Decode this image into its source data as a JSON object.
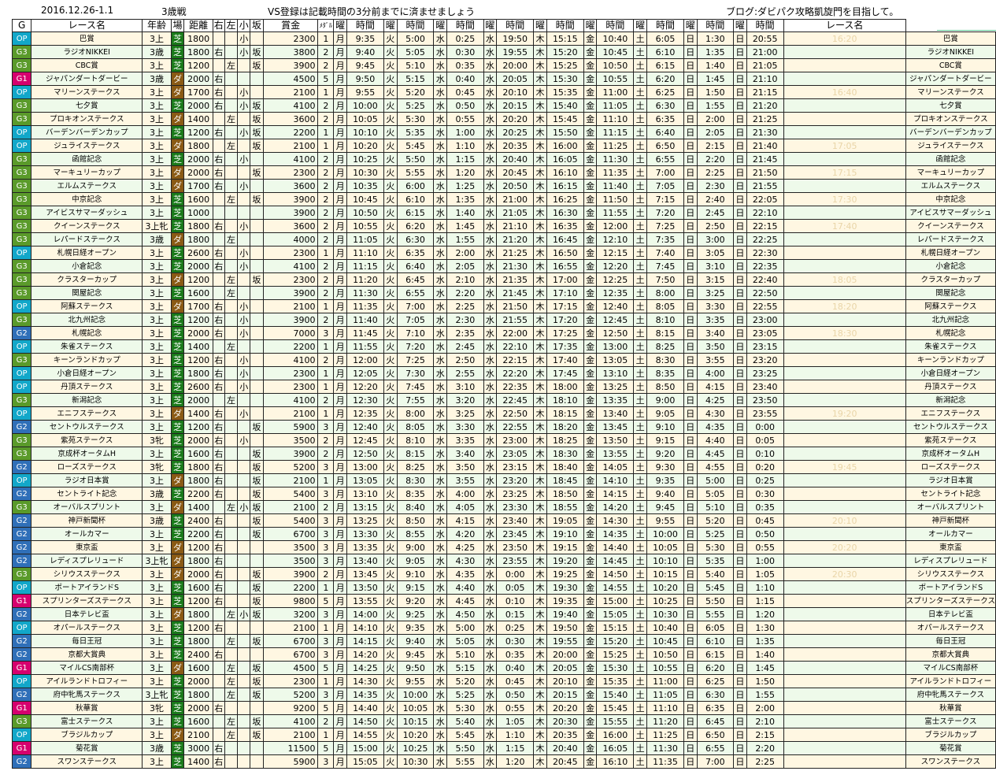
{
  "header": {
    "date_range": "2016.12.26-1.1",
    "category": "3歳戦",
    "notice": "VS登録は記載時間の3分前までに済ませましょう",
    "blog": "ブログ:ダビパク攻略凱旋門を目指して。"
  },
  "columns": [
    "G",
    "レース名",
    "年齢",
    "場",
    "距離",
    "右",
    "左",
    "小",
    "坂",
    "賞金",
    "ﾒﾀﾞﾙ",
    "曜",
    "時間",
    "曜",
    "時間",
    "曜",
    "時間",
    "曜",
    "時間",
    "曜",
    "時間",
    "曜",
    "時間",
    "曜",
    "時間",
    "曜",
    "時間",
    "曜",
    "時間",
    "レース名"
  ],
  "weekday_cols": [
    "月",
    "火",
    "水",
    "水",
    "木",
    "金",
    "土",
    "日",
    "日"
  ],
  "surface_colors": {
    "芝": "#1a7a1a",
    "ダ": "#8a5a14"
  },
  "grade_colors": {
    "G1": "#d6006e",
    "G2": "#2f6fb8",
    "G3": "#5a9a2a",
    "OP": "#12a7c9"
  },
  "rows": [
    [
      "OP",
      "巴賞",
      "3上",
      "芝",
      "1800",
      "",
      "",
      "小",
      "",
      "2300",
      "1",
      "9:35",
      "5:00",
      "0:25",
      "19:50",
      "15:15",
      "10:40",
      "6:05",
      "1:30",
      "20:55",
      "16:20"
    ],
    [
      "G3",
      "ラジオNIKKEI",
      "3歳",
      "芝",
      "1800",
      "右",
      "",
      "小",
      "坂",
      "3800",
      "2",
      "9:40",
      "5:05",
      "0:30",
      "19:55",
      "15:20",
      "10:45",
      "6:10",
      "1:35",
      "21:00",
      ""
    ],
    [
      "G3",
      "CBC賞",
      "3上",
      "芝",
      "1200",
      "",
      "左",
      "",
      "坂",
      "3900",
      "2",
      "9:45",
      "5:10",
      "0:35",
      "20:00",
      "15:25",
      "10:50",
      "6:15",
      "1:40",
      "21:05",
      ""
    ],
    [
      "G1",
      "ジャパンダートダービー",
      "3歳",
      "ダ",
      "2000",
      "右",
      "",
      "",
      "",
      "4500",
      "5",
      "9:50",
      "5:15",
      "0:40",
      "20:05",
      "15:30",
      "10:55",
      "6:20",
      "1:45",
      "21:10",
      ""
    ],
    [
      "OP",
      "マリーンステークス",
      "3上",
      "ダ",
      "1700",
      "右",
      "",
      "小",
      "",
      "2100",
      "1",
      "9:55",
      "5:20",
      "0:45",
      "20:10",
      "15:35",
      "11:00",
      "6:25",
      "1:50",
      "21:15",
      "16:40"
    ],
    [
      "G3",
      "七夕賞",
      "3上",
      "芝",
      "2000",
      "右",
      "",
      "小",
      "坂",
      "4100",
      "2",
      "10:00",
      "5:25",
      "0:50",
      "20:15",
      "15:40",
      "11:05",
      "6:30",
      "1:55",
      "21:20",
      ""
    ],
    [
      "G3",
      "プロキオンステークス",
      "3上",
      "ダ",
      "1400",
      "",
      "左",
      "",
      "坂",
      "3600",
      "2",
      "10:05",
      "5:30",
      "0:55",
      "20:20",
      "15:45",
      "11:10",
      "6:35",
      "2:00",
      "21:25",
      ""
    ],
    [
      "OP",
      "バーデンバーデンカップ",
      "3上",
      "芝",
      "1200",
      "右",
      "",
      "小",
      "坂",
      "2200",
      "1",
      "10:10",
      "5:35",
      "1:00",
      "20:25",
      "15:50",
      "11:15",
      "6:40",
      "2:05",
      "21:30",
      ""
    ],
    [
      "OP",
      "ジュライステークス",
      "3上",
      "ダ",
      "1800",
      "",
      "左",
      "",
      "坂",
      "2100",
      "1",
      "10:20",
      "5:45",
      "1:10",
      "20:35",
      "16:00",
      "11:25",
      "6:50",
      "2:15",
      "21:40",
      "17:05"
    ],
    [
      "G3",
      "函館記念",
      "3上",
      "芝",
      "2000",
      "右",
      "",
      "小",
      "",
      "4100",
      "2",
      "10:25",
      "5:50",
      "1:15",
      "20:40",
      "16:05",
      "11:30",
      "6:55",
      "2:20",
      "21:45",
      ""
    ],
    [
      "G3",
      "マーキュリーカップ",
      "3上",
      "ダ",
      "2000",
      "右",
      "",
      "",
      "坂",
      "2300",
      "2",
      "10:30",
      "5:55",
      "1:20",
      "20:45",
      "16:10",
      "11:35",
      "7:00",
      "2:25",
      "21:50",
      "17:15"
    ],
    [
      "G3",
      "エルムステークス",
      "3上",
      "ダ",
      "1700",
      "右",
      "",
      "小",
      "",
      "3600",
      "2",
      "10:35",
      "6:00",
      "1:25",
      "20:50",
      "16:15",
      "11:40",
      "7:05",
      "2:30",
      "21:55",
      ""
    ],
    [
      "G3",
      "中京記念",
      "3上",
      "芝",
      "1600",
      "",
      "左",
      "",
      "坂",
      "3900",
      "2",
      "10:45",
      "6:10",
      "1:35",
      "21:00",
      "16:25",
      "11:50",
      "7:15",
      "2:40",
      "22:05",
      "17:30"
    ],
    [
      "G3",
      "アイビスサマーダッシュ",
      "3上",
      "芝",
      "1000",
      "",
      "",
      "",
      "",
      "3900",
      "2",
      "10:50",
      "6:15",
      "1:40",
      "21:05",
      "16:30",
      "11:55",
      "7:20",
      "2:45",
      "22:10",
      ""
    ],
    [
      "G3",
      "クイーンステークス",
      "3上牝",
      "芝",
      "1800",
      "右",
      "",
      "小",
      "",
      "3600",
      "2",
      "10:55",
      "6:20",
      "1:45",
      "21:10",
      "16:35",
      "12:00",
      "7:25",
      "2:50",
      "22:15",
      "17:40"
    ],
    [
      "G3",
      "レパードステークス",
      "3歳",
      "ダ",
      "1800",
      "",
      "左",
      "",
      "",
      "4000",
      "2",
      "11:05",
      "6:30",
      "1:55",
      "21:20",
      "16:45",
      "12:10",
      "7:35",
      "3:00",
      "22:25",
      ""
    ],
    [
      "OP",
      "札幌日経オープン",
      "3上",
      "芝",
      "2600",
      "右",
      "",
      "小",
      "",
      "2300",
      "1",
      "11:10",
      "6:35",
      "2:00",
      "21:25",
      "16:50",
      "12:15",
      "7:40",
      "3:05",
      "22:30",
      ""
    ],
    [
      "G3",
      "小倉記念",
      "3上",
      "芝",
      "2000",
      "右",
      "",
      "小",
      "",
      "4100",
      "2",
      "11:15",
      "6:40",
      "2:05",
      "21:30",
      "16:55",
      "12:20",
      "7:45",
      "3:10",
      "22:35",
      ""
    ],
    [
      "G3",
      "クラスターカップ",
      "3上",
      "ダ",
      "1200",
      "",
      "左",
      "",
      "坂",
      "2300",
      "2",
      "11:20",
      "6:45",
      "2:10",
      "21:35",
      "17:00",
      "12:25",
      "7:50",
      "3:15",
      "22:40",
      "18:05"
    ],
    [
      "G3",
      "関屋記念",
      "3上",
      "芝",
      "1600",
      "",
      "左",
      "",
      "",
      "3900",
      "2",
      "11:30",
      "6:55",
      "2:20",
      "21:45",
      "17:10",
      "12:35",
      "8:00",
      "3:25",
      "22:50",
      ""
    ],
    [
      "OP",
      "阿蘇ステークス",
      "3上",
      "ダ",
      "1700",
      "右",
      "",
      "小",
      "",
      "2100",
      "1",
      "11:35",
      "7:00",
      "2:25",
      "21:50",
      "17:15",
      "12:40",
      "8:05",
      "3:30",
      "22:55",
      "18:20"
    ],
    [
      "G3",
      "北九州記念",
      "3上",
      "芝",
      "1200",
      "右",
      "",
      "小",
      "",
      "3900",
      "2",
      "11:40",
      "7:05",
      "2:30",
      "21:55",
      "17:20",
      "12:45",
      "8:10",
      "3:35",
      "23:00",
      ""
    ],
    [
      "G2",
      "札幌記念",
      "3上",
      "芝",
      "2000",
      "右",
      "",
      "小",
      "",
      "7000",
      "3",
      "11:45",
      "7:10",
      "2:35",
      "22:00",
      "17:25",
      "12:50",
      "8:15",
      "3:40",
      "23:05",
      "18:30"
    ],
    [
      "OP",
      "朱雀ステークス",
      "3上",
      "芝",
      "1400",
      "",
      "左",
      "",
      "",
      "2200",
      "1",
      "11:55",
      "7:20",
      "2:45",
      "22:10",
      "17:35",
      "13:00",
      "8:25",
      "3:50",
      "23:15",
      ""
    ],
    [
      "G3",
      "キーンランドカップ",
      "3上",
      "芝",
      "1200",
      "右",
      "",
      "小",
      "",
      "4100",
      "2",
      "12:00",
      "7:25",
      "2:50",
      "22:15",
      "17:40",
      "13:05",
      "8:30",
      "3:55",
      "23:20",
      ""
    ],
    [
      "OP",
      "小倉日経オープン",
      "3上",
      "芝",
      "1800",
      "右",
      "",
      "小",
      "",
      "2300",
      "1",
      "12:05",
      "7:30",
      "2:55",
      "22:20",
      "17:45",
      "13:10",
      "8:35",
      "4:00",
      "23:25",
      ""
    ],
    [
      "OP",
      "丹頂ステークス",
      "3上",
      "芝",
      "2600",
      "右",
      "",
      "小",
      "",
      "2300",
      "1",
      "12:20",
      "7:45",
      "3:10",
      "22:35",
      "18:00",
      "13:25",
      "8:50",
      "4:15",
      "23:40",
      ""
    ],
    [
      "G3",
      "新潟記念",
      "3上",
      "芝",
      "2000",
      "",
      "左",
      "",
      "",
      "4100",
      "2",
      "12:30",
      "7:55",
      "3:20",
      "22:45",
      "18:10",
      "13:35",
      "9:00",
      "4:25",
      "23:50",
      ""
    ],
    [
      "OP",
      "エニフステークス",
      "3上",
      "ダ",
      "1400",
      "右",
      "",
      "小",
      "",
      "2100",
      "1",
      "12:35",
      "8:00",
      "3:25",
      "22:50",
      "18:15",
      "13:40",
      "9:05",
      "4:30",
      "23:55",
      "19:20"
    ],
    [
      "G2",
      "セントウルステークス",
      "3上",
      "芝",
      "1200",
      "右",
      "",
      "",
      "坂",
      "5900",
      "3",
      "12:40",
      "8:05",
      "3:30",
      "22:55",
      "18:20",
      "13:45",
      "9:10",
      "4:35",
      "0:00",
      ""
    ],
    [
      "G3",
      "紫苑ステークス",
      "3牝",
      "芝",
      "2000",
      "右",
      "",
      "小",
      "",
      "3500",
      "2",
      "12:45",
      "8:10",
      "3:35",
      "23:00",
      "18:25",
      "13:50",
      "9:15",
      "4:40",
      "0:05",
      ""
    ],
    [
      "G3",
      "京成杯オータムH",
      "3上",
      "芝",
      "1600",
      "右",
      "",
      "",
      "坂",
      "3900",
      "2",
      "12:50",
      "8:15",
      "3:40",
      "23:05",
      "18:30",
      "13:55",
      "9:20",
      "4:45",
      "0:10",
      ""
    ],
    [
      "G2",
      "ローズステークス",
      "3牝",
      "芝",
      "1800",
      "右",
      "",
      "",
      "坂",
      "5200",
      "3",
      "13:00",
      "8:25",
      "3:50",
      "23:15",
      "18:40",
      "14:05",
      "9:30",
      "4:55",
      "0:20",
      "19:45"
    ],
    [
      "OP",
      "ラジオ日本賞",
      "3上",
      "ダ",
      "1800",
      "右",
      "",
      "",
      "坂",
      "2100",
      "1",
      "13:05",
      "8:30",
      "3:55",
      "23:20",
      "18:45",
      "14:10",
      "9:35",
      "5:00",
      "0:25",
      ""
    ],
    [
      "G2",
      "セントライト記念",
      "3歳",
      "芝",
      "2200",
      "右",
      "",
      "",
      "坂",
      "5400",
      "3",
      "13:10",
      "8:35",
      "4:00",
      "23:25",
      "18:50",
      "14:15",
      "9:40",
      "5:05",
      "0:30",
      ""
    ],
    [
      "G3",
      "オーバルスプリント",
      "3上",
      "ダ",
      "1400",
      "",
      "左",
      "小",
      "坂",
      "2100",
      "2",
      "13:15",
      "8:40",
      "4:05",
      "23:30",
      "18:55",
      "14:20",
      "9:45",
      "5:10",
      "0:35",
      ""
    ],
    [
      "G2",
      "神戸新聞杯",
      "3歳",
      "芝",
      "2400",
      "右",
      "",
      "",
      "坂",
      "5400",
      "3",
      "13:25",
      "8:50",
      "4:15",
      "23:40",
      "19:05",
      "14:30",
      "9:55",
      "5:20",
      "0:45",
      "20:10"
    ],
    [
      "G2",
      "オールカマー",
      "3上",
      "芝",
      "2200",
      "右",
      "",
      "",
      "坂",
      "6700",
      "3",
      "13:30",
      "8:55",
      "4:20",
      "23:45",
      "19:10",
      "14:35",
      "10:00",
      "5:25",
      "0:50",
      ""
    ],
    [
      "G2",
      "東京盃",
      "3上",
      "ダ",
      "1200",
      "右",
      "",
      "",
      "",
      "3500",
      "3",
      "13:35",
      "9:00",
      "4:25",
      "23:50",
      "19:15",
      "14:40",
      "10:05",
      "5:30",
      "0:55",
      "20:20"
    ],
    [
      "G2",
      "レディスプレリュード",
      "3上牝",
      "ダ",
      "1800",
      "右",
      "",
      "",
      "",
      "3500",
      "3",
      "13:40",
      "9:05",
      "4:30",
      "23:55",
      "19:20",
      "14:45",
      "10:10",
      "5:35",
      "1:00",
      ""
    ],
    [
      "G3",
      "シリウスステークス",
      "3上",
      "ダ",
      "2000",
      "右",
      "",
      "",
      "坂",
      "3900",
      "2",
      "13:45",
      "9:10",
      "4:35",
      "0:00",
      "19:25",
      "14:50",
      "10:15",
      "5:40",
      "1:05",
      "20:30"
    ],
    [
      "OP",
      "ポートアイランドS",
      "3上",
      "芝",
      "1600",
      "右",
      "",
      "",
      "坂",
      "2200",
      "1",
      "13:50",
      "9:15",
      "4:40",
      "0:05",
      "19:30",
      "14:55",
      "10:20",
      "5:45",
      "1:10",
      ""
    ],
    [
      "G1",
      "スプリンターズステークス",
      "3上",
      "芝",
      "1200",
      "右",
      "",
      "",
      "坂",
      "9800",
      "5",
      "13:55",
      "9:20",
      "4:45",
      "0:10",
      "19:35",
      "15:00",
      "10:25",
      "5:50",
      "1:15",
      ""
    ],
    [
      "G2",
      "日本テレビ盃",
      "3上",
      "ダ",
      "1800",
      "",
      "左",
      "小",
      "坂",
      "3200",
      "3",
      "14:00",
      "9:25",
      "4:50",
      "0:15",
      "19:40",
      "15:05",
      "10:30",
      "5:55",
      "1:20",
      ""
    ],
    [
      "OP",
      "オパールステークス",
      "3上",
      "芝",
      "1200",
      "右",
      "",
      "",
      "",
      "2100",
      "1",
      "14:10",
      "9:35",
      "5:00",
      "0:25",
      "19:50",
      "15:15",
      "10:40",
      "6:05",
      "1:30",
      ""
    ],
    [
      "G2",
      "毎日王冠",
      "3上",
      "芝",
      "1800",
      "",
      "左",
      "",
      "坂",
      "6700",
      "3",
      "14:15",
      "9:40",
      "5:05",
      "0:30",
      "19:55",
      "15:20",
      "10:45",
      "6:10",
      "1:35",
      ""
    ],
    [
      "G2",
      "京都大賞典",
      "3上",
      "芝",
      "2400",
      "右",
      "",
      "",
      "",
      "6700",
      "3",
      "14:20",
      "9:45",
      "5:10",
      "0:35",
      "20:00",
      "15:25",
      "10:50",
      "6:15",
      "1:40",
      ""
    ],
    [
      "G1",
      "マイルCS南部杯",
      "3上",
      "ダ",
      "1600",
      "",
      "左",
      "",
      "坂",
      "4500",
      "5",
      "14:25",
      "9:50",
      "5:15",
      "0:40",
      "20:05",
      "15:30",
      "10:55",
      "6:20",
      "1:45",
      ""
    ],
    [
      "OP",
      "アイルランドトロフィー",
      "3上",
      "芝",
      "2000",
      "",
      "左",
      "",
      "坂",
      "2300",
      "1",
      "14:30",
      "9:55",
      "5:20",
      "0:45",
      "20:10",
      "15:35",
      "11:00",
      "6:25",
      "1:50",
      ""
    ],
    [
      "G2",
      "府中牝馬ステークス",
      "3上牝",
      "芝",
      "1800",
      "",
      "左",
      "",
      "坂",
      "5200",
      "3",
      "14:35",
      "10:00",
      "5:25",
      "0:50",
      "20:15",
      "15:40",
      "11:05",
      "6:30",
      "1:55",
      ""
    ],
    [
      "G1",
      "秋華賞",
      "3牝",
      "芝",
      "2000",
      "右",
      "",
      "",
      "",
      "9200",
      "5",
      "14:40",
      "10:05",
      "5:30",
      "0:55",
      "20:20",
      "15:45",
      "11:10",
      "6:35",
      "2:00",
      ""
    ],
    [
      "G3",
      "富士ステークス",
      "3上",
      "芝",
      "1600",
      "",
      "左",
      "",
      "坂",
      "4100",
      "2",
      "14:50",
      "10:15",
      "5:40",
      "1:05",
      "20:30",
      "15:55",
      "11:20",
      "6:45",
      "2:10",
      ""
    ],
    [
      "OP",
      "ブラジルカップ",
      "3上",
      "ダ",
      "2100",
      "",
      "左",
      "",
      "坂",
      "2100",
      "1",
      "14:55",
      "10:20",
      "5:45",
      "1:10",
      "20:35",
      "16:00",
      "11:25",
      "6:50",
      "2:15",
      ""
    ],
    [
      "G1",
      "菊花賞",
      "3歳",
      "芝",
      "3000",
      "右",
      "",
      "",
      "",
      "11500",
      "5",
      "15:00",
      "10:25",
      "5:50",
      "1:15",
      "20:40",
      "16:05",
      "11:30",
      "6:55",
      "2:20",
      ""
    ],
    [
      "G2",
      "スワンステークス",
      "3上",
      "芝",
      "1400",
      "右",
      "",
      "",
      "",
      "5900",
      "3",
      "15:05",
      "10:30",
      "5:55",
      "1:20",
      "20:45",
      "16:10",
      "11:35",
      "7:00",
      "2:25",
      ""
    ]
  ]
}
